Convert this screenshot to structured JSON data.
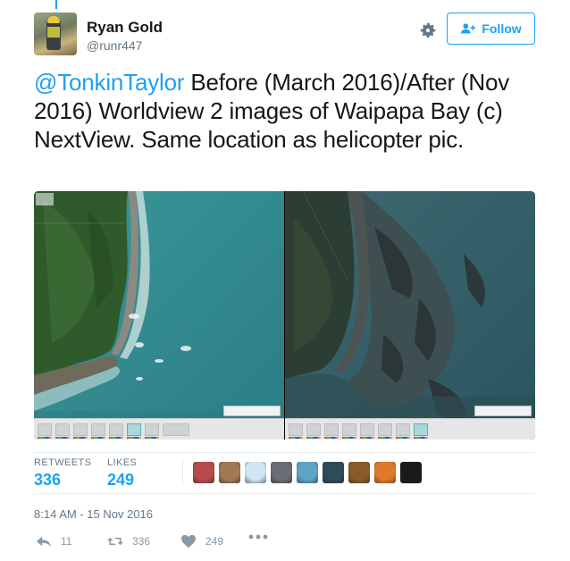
{
  "user": {
    "name": "Ryan Gold",
    "handle": "@runr447"
  },
  "follow_button": {
    "label": "Follow"
  },
  "tweet": {
    "mention": "@TonkinTaylor",
    "text": " Before (March 2016)/After (Nov 2016) Worldview 2 images of Waipapa Bay (c) NextView. Same location as helicopter pic."
  },
  "stats": {
    "retweets_label": "RETWEETS",
    "retweets": "336",
    "likes_label": "LIKES",
    "likes": "249"
  },
  "timestamp": "8:14 AM - 15 Nov 2016",
  "actions": {
    "reply_count": "11",
    "retweet_count": "336",
    "like_count": "249"
  },
  "liker_avatars": [
    {
      "name": "liker-avatar-1",
      "color": "#b84a4a"
    },
    {
      "name": "liker-avatar-2",
      "color": "#a07a52"
    },
    {
      "name": "liker-avatar-3",
      "color": "#cfe6f5"
    },
    {
      "name": "liker-avatar-4",
      "color": "#6a6e74"
    },
    {
      "name": "liker-avatar-5",
      "color": "#5fa3c8"
    },
    {
      "name": "liker-avatar-6",
      "color": "#2f4a5c"
    },
    {
      "name": "liker-avatar-7",
      "color": "#8a5a2a"
    },
    {
      "name": "liker-avatar-8",
      "color": "#e07a2a"
    },
    {
      "name": "liker-avatar-9",
      "color": "#1a1a1a"
    }
  ],
  "colors": {
    "accent": "#1da1f2",
    "muted": "#657786",
    "action_gray": "#8899a6"
  },
  "icons": {
    "settings": "gear-icon",
    "follow": "add-person-icon",
    "reply": "reply-icon",
    "retweet": "retweet-icon",
    "like": "heart-icon",
    "more": "more-dots-icon"
  }
}
